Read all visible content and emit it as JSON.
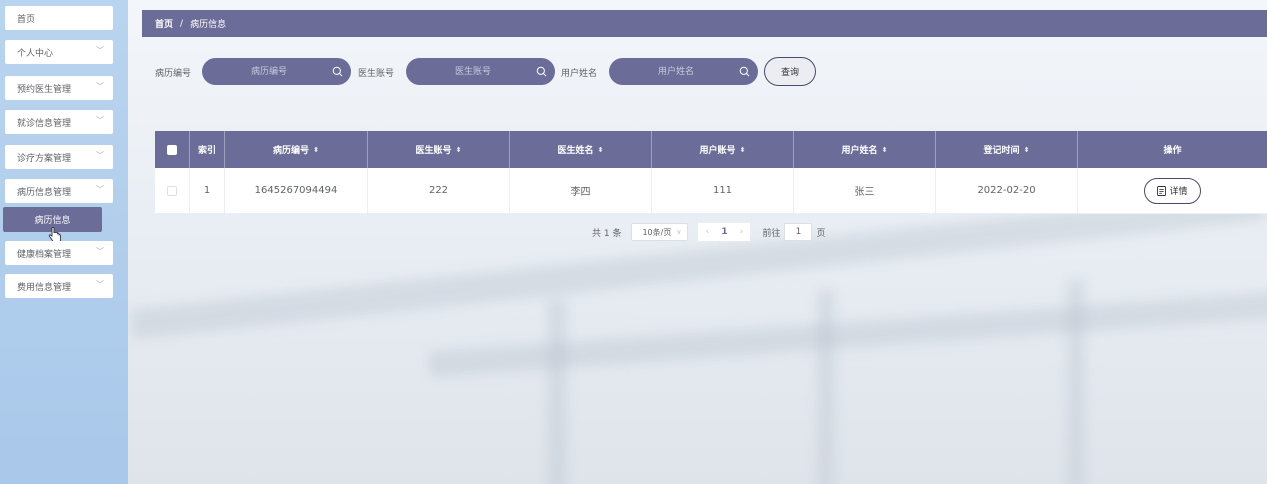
{
  "sidebar": {
    "items": [
      {
        "label": "首页",
        "has_arrow": false
      },
      {
        "label": "个人中心",
        "has_arrow": true
      },
      {
        "label": "预约医生管理",
        "has_arrow": true
      },
      {
        "label": "就诊信息管理",
        "has_arrow": true
      },
      {
        "label": "诊疗方案管理",
        "has_arrow": true
      },
      {
        "label": "病历信息管理",
        "has_arrow": true
      },
      {
        "label": "健康档案管理",
        "has_arrow": true
      },
      {
        "label": "费用信息管理",
        "has_arrow": true
      }
    ],
    "active_sub_item": "病历信息"
  },
  "breadcrumb": {
    "home": "首页",
    "separator": "/",
    "current": "病历信息"
  },
  "search": {
    "fields": [
      {
        "label": "病历编号",
        "placeholder": "病历编号"
      },
      {
        "label": "医生账号",
        "placeholder": "医生账号"
      },
      {
        "label": "用户姓名",
        "placeholder": "用户姓名"
      }
    ],
    "query_button": "查询"
  },
  "table": {
    "columns": [
      "索引",
      "病历编号",
      "医生账号",
      "医生姓名",
      "用户账号",
      "用户姓名",
      "登记时间",
      "操作"
    ],
    "rows": [
      {
        "index": "1",
        "record_no": "1645267094494",
        "doctor_account": "222",
        "doctor_name": "李四",
        "user_account": "111",
        "user_name": "张三",
        "date": "2022-02-20",
        "action": "详情"
      }
    ]
  },
  "pagination": {
    "total": "共 1 条",
    "page_size": "10条/页",
    "current_page": "1",
    "goto_label": "前往",
    "goto_value": "1",
    "page_suffix": "页"
  },
  "colors": {
    "accent": "#6b6d98",
    "sidebar_bg": "#b3cfed"
  }
}
